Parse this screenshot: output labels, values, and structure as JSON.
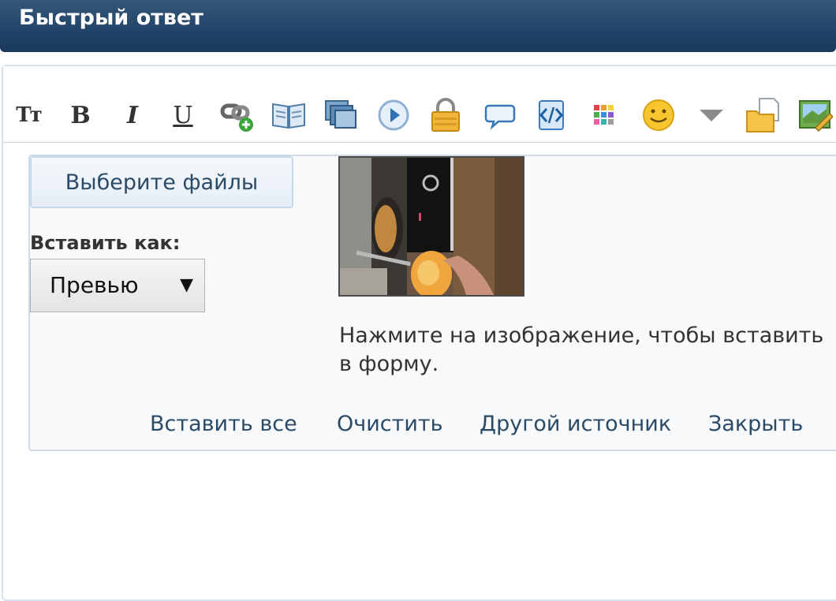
{
  "header": {
    "title": "Быстрый ответ"
  },
  "toolbar": {
    "items": [
      {
        "name": "font-size-icon",
        "glyph": "Tт"
      },
      {
        "name": "bold-icon",
        "glyph": "B"
      },
      {
        "name": "italic-icon",
        "glyph": "I"
      },
      {
        "name": "underline-icon",
        "glyph": "U"
      },
      {
        "name": "insert-link-icon"
      },
      {
        "name": "book-icon"
      },
      {
        "name": "gallery-icon"
      },
      {
        "name": "media-play-icon"
      },
      {
        "name": "lock-icon"
      },
      {
        "name": "speech-bubble-icon"
      },
      {
        "name": "code-icon"
      },
      {
        "name": "color-palette-icon"
      },
      {
        "name": "smiley-icon"
      },
      {
        "name": "dropdown-arrow-icon"
      },
      {
        "name": "folder-document-icon"
      },
      {
        "name": "image-edit-icon"
      }
    ]
  },
  "upload": {
    "choose_files_label": "Выберите файлы",
    "insert_as_label": "Вставить как:",
    "insert_as_value": "Превью",
    "hint": "Нажмите на изображение, чтобы вставить в форму.",
    "actions": {
      "insert_all": "Вставить все",
      "clear": "Очистить",
      "other_source": "Другой источник",
      "close": "Закрыть"
    }
  },
  "colors": {
    "header_bg": "#23456a",
    "link": "#2b4a66",
    "panel_border": "#cfdce8"
  }
}
